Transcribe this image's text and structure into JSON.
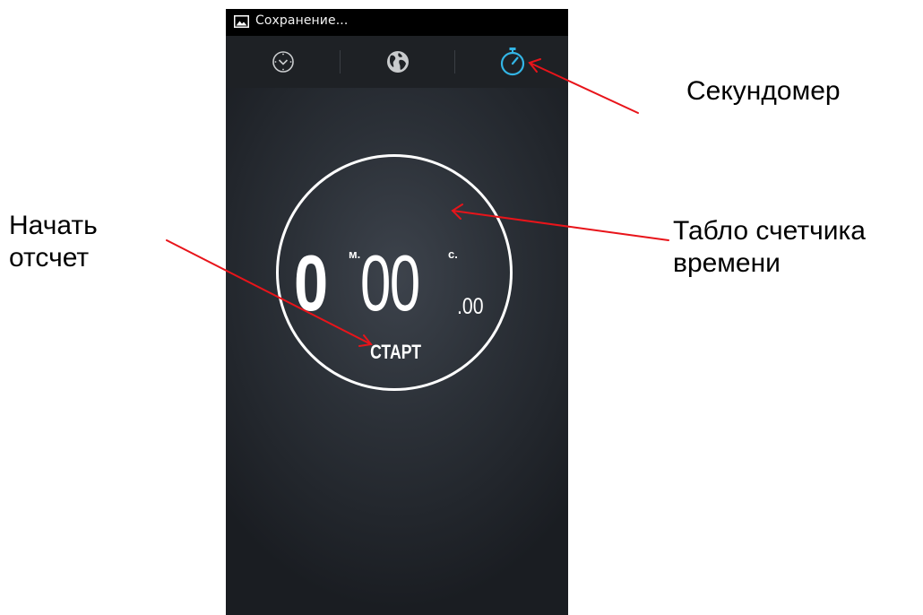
{
  "status_bar": {
    "icon": "gallery-image-icon",
    "text": "Сохранение..."
  },
  "tabs": [
    {
      "icon": "clock-icon",
      "selected": false
    },
    {
      "icon": "globe-icon",
      "selected": false
    },
    {
      "icon": "stopwatch-icon",
      "selected": true
    }
  ],
  "stopwatch": {
    "minutes": "0",
    "minutes_unit": "м.",
    "seconds": "00",
    "seconds_unit": "с.",
    "hundredths": ".00",
    "start_label": "СТАРТ"
  },
  "annotations": {
    "stopwatch_label": "Секундомер",
    "start_label_line1": "Начать",
    "start_label_line2": "отсчет",
    "display_label_line1": "Табло счетчика",
    "display_label_line2": "времени"
  },
  "colors": {
    "accent": "#33b5e5",
    "arrow": "#e8141a",
    "status_bar": "#000000",
    "tab_bar": "#1e2125"
  }
}
